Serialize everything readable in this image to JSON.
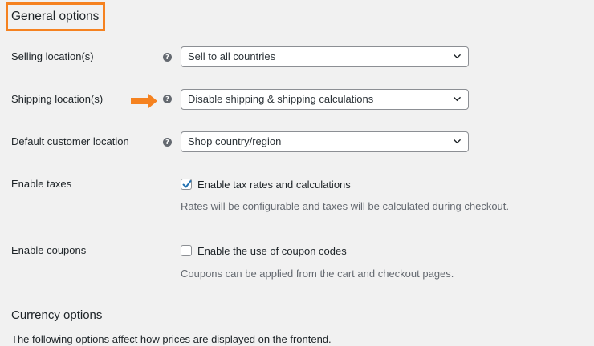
{
  "general_options": {
    "title": "General options"
  },
  "selling_location": {
    "label": "Selling location(s)",
    "value": "Sell to all countries",
    "help_icon": "help-icon"
  },
  "shipping_location": {
    "label": "Shipping location(s)",
    "value": "Disable shipping & shipping calculations",
    "help_icon": "help-icon",
    "annotation": "orange-arrow"
  },
  "default_customer_location": {
    "label": "Default customer location",
    "value": "Shop country/region",
    "help_icon": "help-icon"
  },
  "enable_taxes": {
    "label": "Enable taxes",
    "checkbox_label": "Enable tax rates and calculations",
    "checked": true,
    "description": "Rates will be configurable and taxes will be calculated during checkout."
  },
  "enable_coupons": {
    "label": "Enable coupons",
    "checkbox_label": "Enable the use of coupon codes",
    "checked": false,
    "description": "Coupons can be applied from the cart and checkout pages."
  },
  "currency_options": {
    "title": "Currency options",
    "intro": "The following options affect how prices are displayed on the frontend."
  },
  "colors": {
    "highlight": "#f58220",
    "checkbox_accent": "#2271b1",
    "help_icon": "#646970"
  }
}
